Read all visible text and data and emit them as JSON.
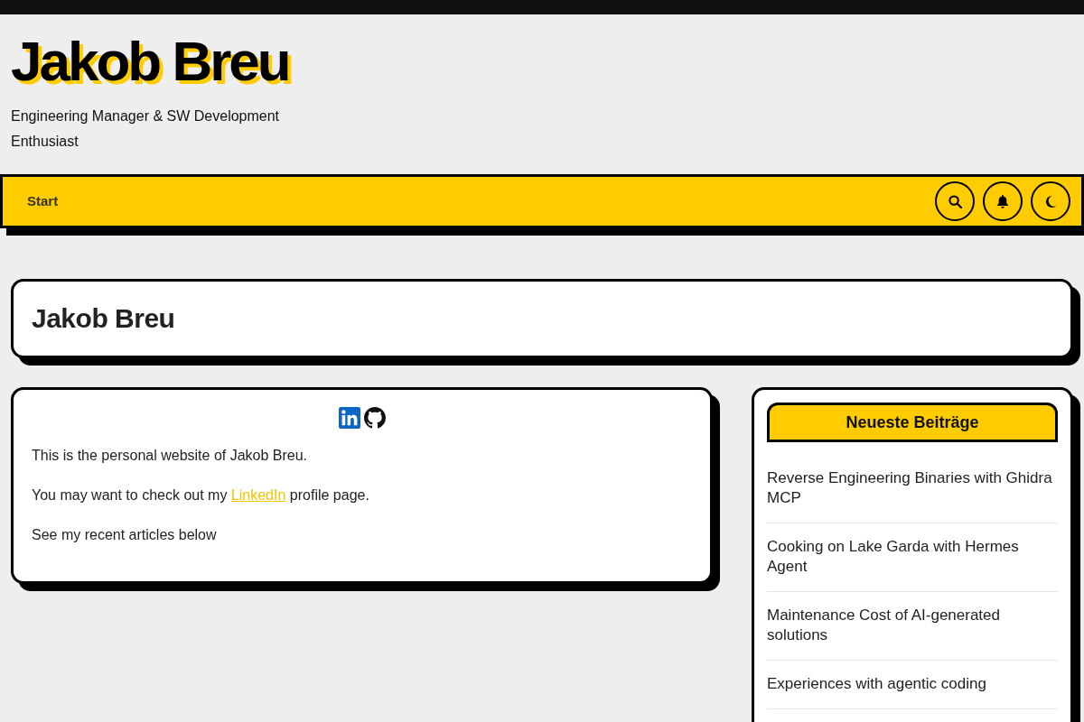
{
  "site": {
    "title": "Jakob Breu",
    "tagline": "Engineering Manager & SW Development Enthusiast"
  },
  "nav": {
    "items": [
      {
        "label": "Start"
      }
    ]
  },
  "page_title": "Jakob Breu",
  "content": {
    "paragraphs": [
      [
        {
          "kind": "text",
          "text": "This is the personal website of Jakob Breu."
        }
      ],
      [
        {
          "kind": "text",
          "text": "You may want to check out my "
        },
        {
          "kind": "link",
          "text": "LinkedIn"
        },
        {
          "kind": "text",
          "text": " profile page."
        }
      ],
      [
        {
          "kind": "text",
          "text": "See my recent articles below"
        }
      ]
    ]
  },
  "sidebar": {
    "title": "Neueste Beiträge",
    "posts": [
      "Reverse Engineering Binaries with Ghidra MCP",
      "Cooking on Lake Garda with Hermes Agent",
      "Maintenance Cost of AI-generated solutions",
      "Experiences with agentic coding"
    ]
  }
}
